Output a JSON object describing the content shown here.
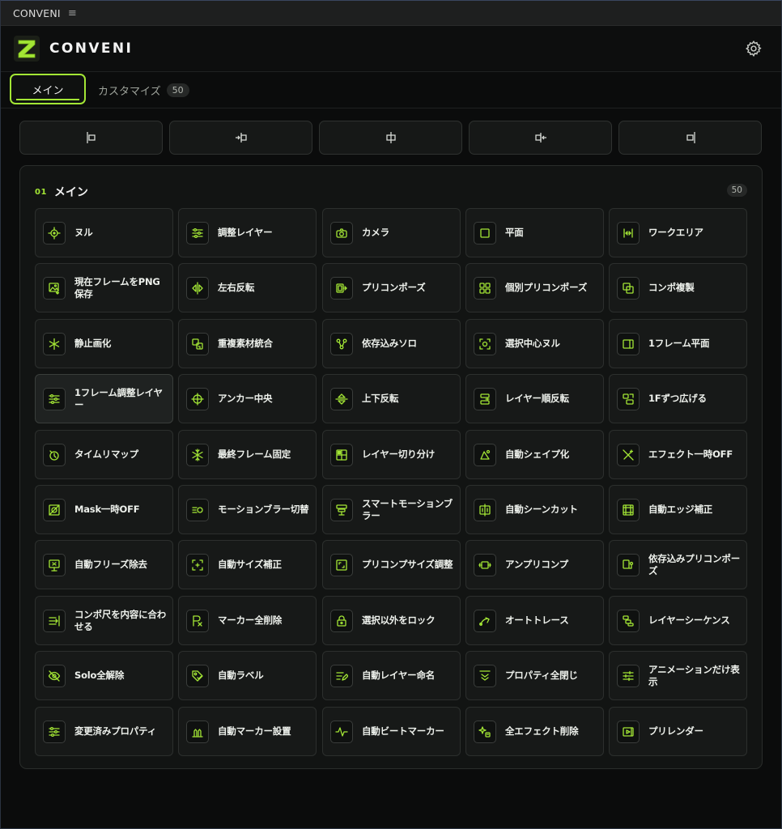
{
  "window": {
    "title": "CONVENI",
    "menu_icon": "hamburger-icon"
  },
  "header": {
    "brand": "CONVENI",
    "logo_icon": "z-logo-icon",
    "settings_icon": "gear-icon"
  },
  "tabs": [
    {
      "label": "メイン",
      "active": true
    },
    {
      "label": "カスタマイズ",
      "badge": "50"
    }
  ],
  "align_buttons": [
    {
      "icon": "align-left-icon"
    },
    {
      "icon": "align-to-left-icon"
    },
    {
      "icon": "align-center-icon"
    },
    {
      "icon": "align-to-right-icon"
    },
    {
      "icon": "align-right-icon"
    }
  ],
  "section": {
    "number": "01",
    "title": "メイン",
    "count": "50"
  },
  "items": [
    {
      "label": "ヌル",
      "icon": "null-crosshair-icon"
    },
    {
      "label": "調整レイヤー",
      "icon": "sliders-icon"
    },
    {
      "label": "カメラ",
      "icon": "camera-icon"
    },
    {
      "label": "平面",
      "icon": "square-icon"
    },
    {
      "label": "ワークエリア",
      "icon": "work-area-icon"
    },
    {
      "label": "現在フレームをPNG保存",
      "icon": "image-save-icon"
    },
    {
      "label": "左右反転",
      "icon": "flip-horizontal-icon"
    },
    {
      "label": "プリコンポーズ",
      "icon": "precompose-icon"
    },
    {
      "label": "個別プリコンポーズ",
      "icon": "grid-icon"
    },
    {
      "label": "コンポ複製",
      "icon": "duplicate-icon"
    },
    {
      "label": "静止画化",
      "icon": "asterisk-icon"
    },
    {
      "label": "重複素材統合",
      "icon": "merge-icon"
    },
    {
      "label": "依存込みソロ",
      "icon": "nodes-icon"
    },
    {
      "label": "選択中心ヌル",
      "icon": "target-frame-icon"
    },
    {
      "label": "1フレーム平面",
      "icon": "frame-solid-icon"
    },
    {
      "label": "1フレーム調整レイヤー",
      "icon": "sliders-icon",
      "highlight": true
    },
    {
      "label": "アンカー中央",
      "icon": "anchor-center-icon"
    },
    {
      "label": "上下反転",
      "icon": "flip-vertical-icon"
    },
    {
      "label": "レイヤー順反転",
      "icon": "layer-order-icon"
    },
    {
      "label": "1Fずつ広げる",
      "icon": "expand-icon"
    },
    {
      "label": "タイムリマップ",
      "icon": "time-remap-icon"
    },
    {
      "label": "最終フレーム固定",
      "icon": "snowflake-icon"
    },
    {
      "label": "レイヤー切り分け",
      "icon": "split-grid-icon"
    },
    {
      "label": "自動シェイプ化",
      "icon": "shape-icon"
    },
    {
      "label": "エフェクト一時OFF",
      "icon": "wand-off-icon"
    },
    {
      "label": "Mask一時OFF",
      "icon": "mask-off-icon"
    },
    {
      "label": "モーションブラー切替",
      "icon": "motion-blur-icon"
    },
    {
      "label": "スマートモーションブラー",
      "icon": "smart-blur-icon"
    },
    {
      "label": "自動シーンカット",
      "icon": "scene-cut-icon"
    },
    {
      "label": "自動エッジ補正",
      "icon": "edge-icon"
    },
    {
      "label": "自動フリーズ除去",
      "icon": "freeze-remove-icon"
    },
    {
      "label": "自動サイズ補正",
      "icon": "size-fix-icon"
    },
    {
      "label": "プリコンプサイズ調整",
      "icon": "resize-icon"
    },
    {
      "label": "アンプリコンプ",
      "icon": "unprecomp-icon"
    },
    {
      "label": "依存込みプリコンポーズ",
      "icon": "dep-precompose-icon"
    },
    {
      "label": "コンポ尺を内容に合わせる",
      "icon": "fit-duration-icon"
    },
    {
      "label": "マーカー全削除",
      "icon": "marker-delete-icon"
    },
    {
      "label": "選択以外をロック",
      "icon": "lock-icon"
    },
    {
      "label": "オートトレース",
      "icon": "trace-icon"
    },
    {
      "label": "レイヤーシーケンス",
      "icon": "sequence-icon"
    },
    {
      "label": "Solo全解除",
      "icon": "eye-off-icon"
    },
    {
      "label": "自動ラベル",
      "icon": "tag-icon"
    },
    {
      "label": "自動レイヤー命名",
      "icon": "rename-icon"
    },
    {
      "label": "プロパティ全閉じ",
      "icon": "collapse-icon"
    },
    {
      "label": "アニメーションだけ表示",
      "icon": "list-sliders-icon"
    },
    {
      "label": "変更済みプロパティ",
      "icon": "sliders-icon"
    },
    {
      "label": "自動マーカー設置",
      "icon": "marker-place-icon"
    },
    {
      "label": "自動ビートマーカー",
      "icon": "beat-icon"
    },
    {
      "label": "全エフェクト削除",
      "icon": "sparkle-delete-icon"
    },
    {
      "label": "プリレンダー",
      "icon": "prerender-icon"
    }
  ],
  "colors": {
    "accent": "#a3e635",
    "background": "#0b0c0c",
    "panel": "#121413",
    "cell": "#171918"
  }
}
